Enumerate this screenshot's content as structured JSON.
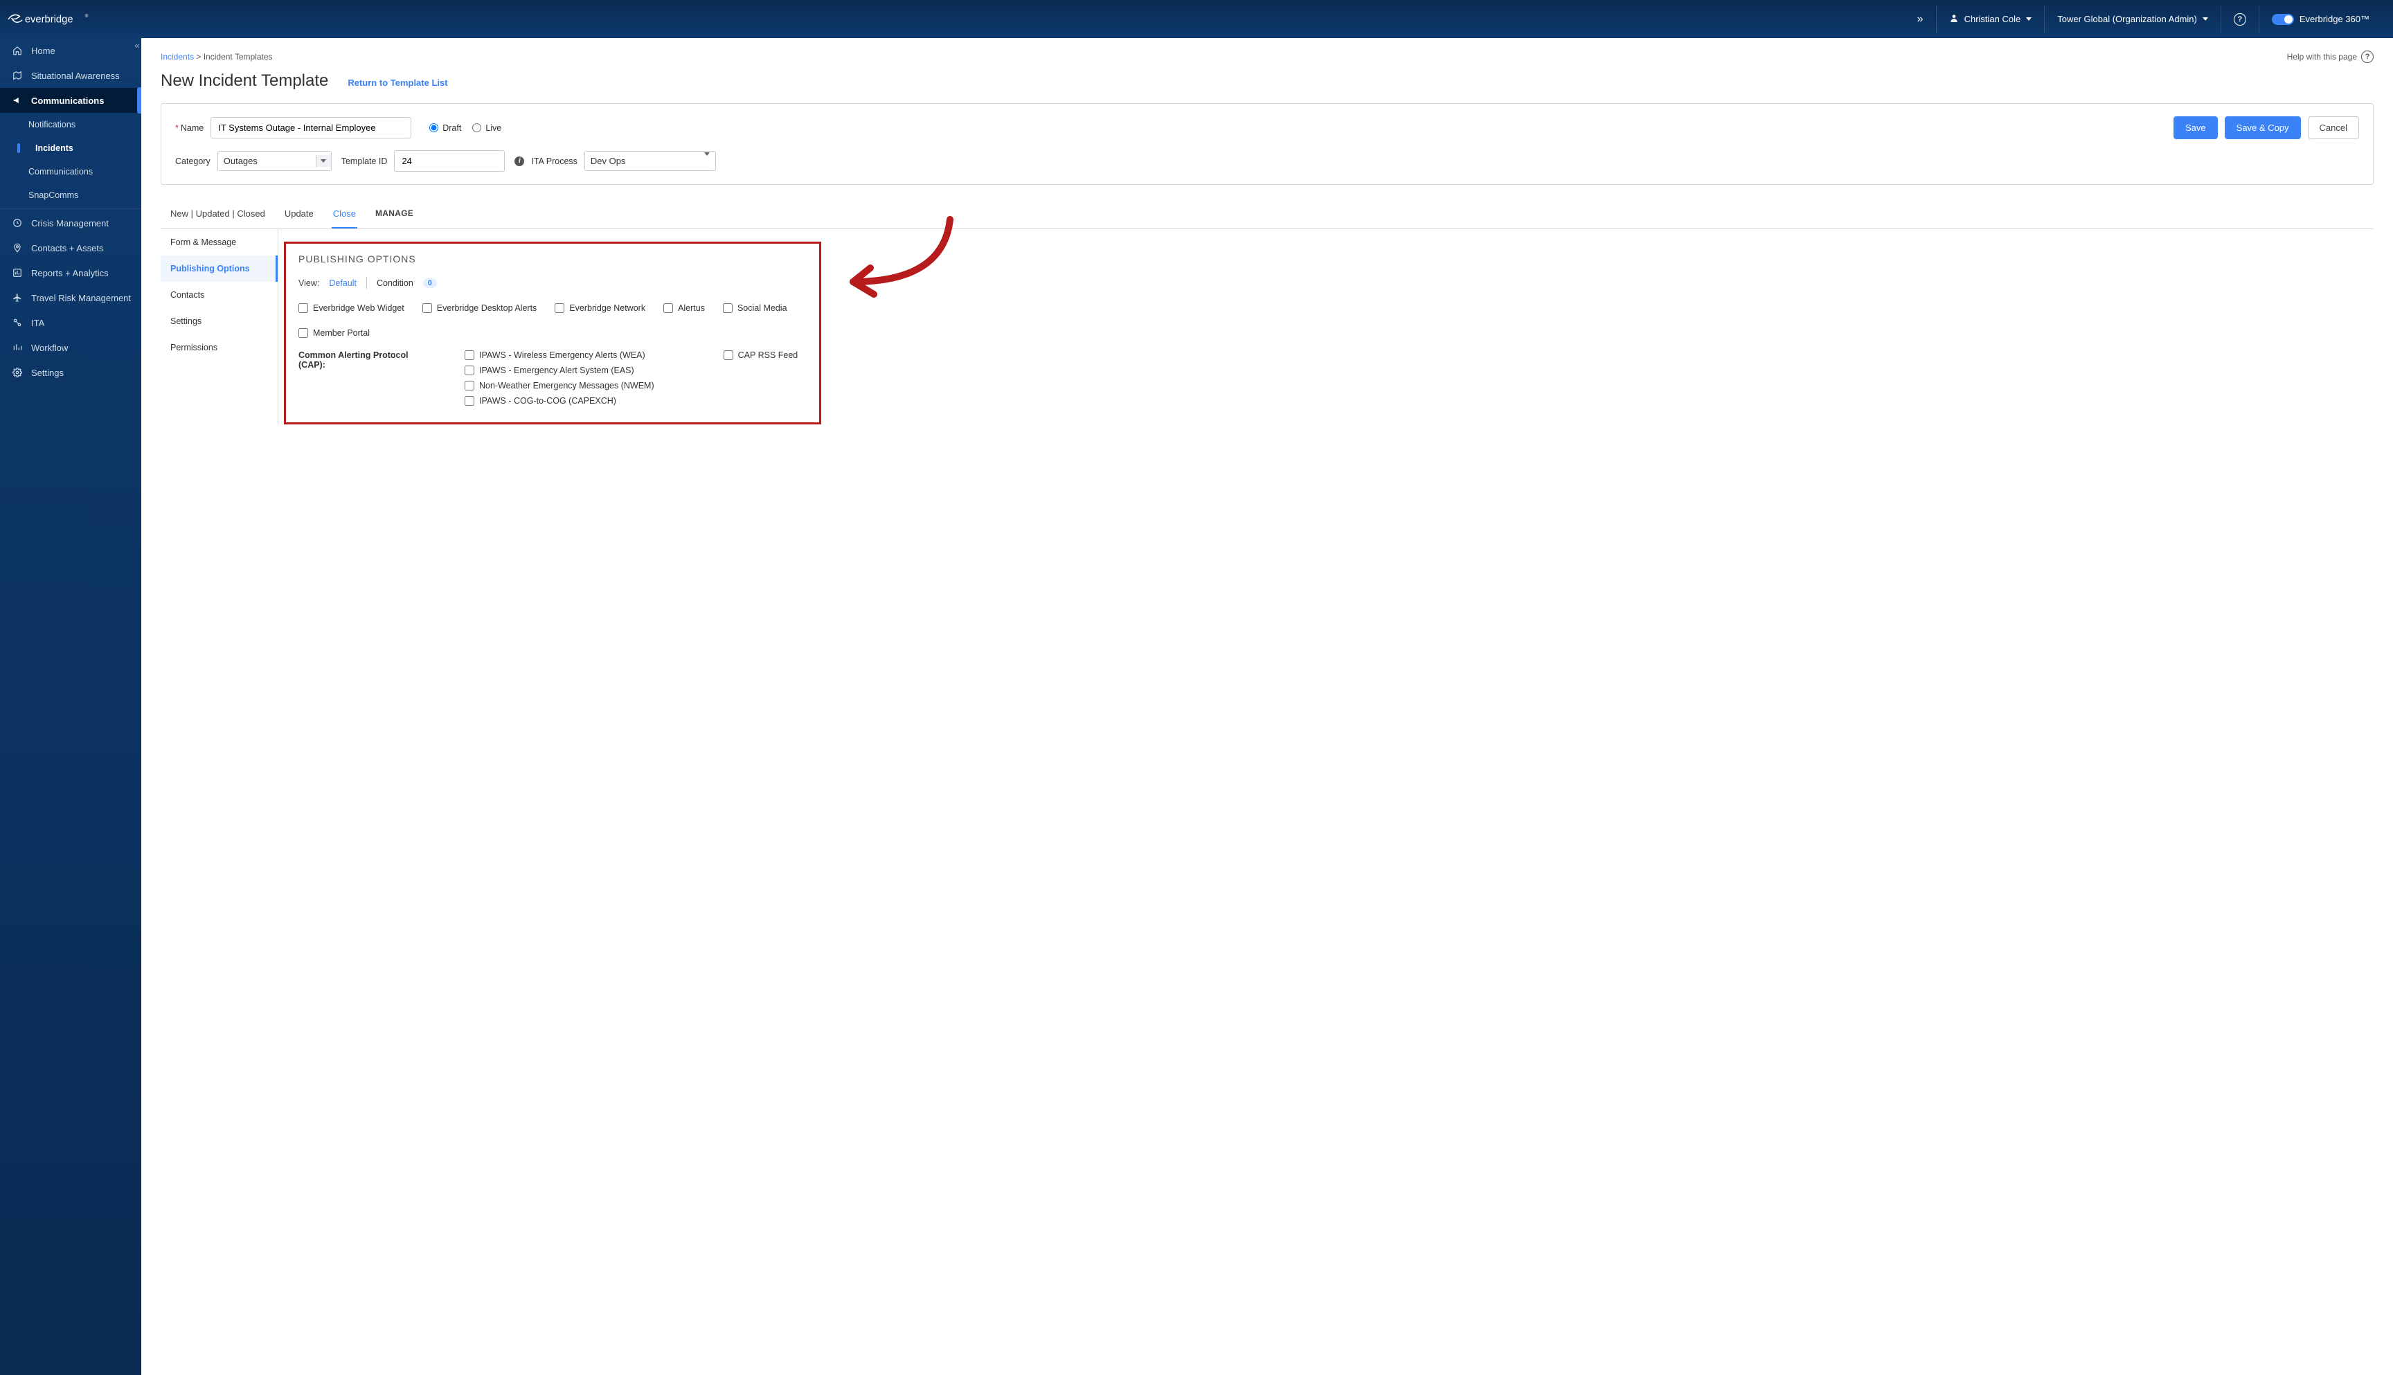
{
  "header": {
    "product": "everbridge",
    "user": "Christian Cole",
    "org": "Tower Global (Organization Admin)",
    "brand_toggle": "Everbridge 360™"
  },
  "sidebar": {
    "items": [
      {
        "label": "Home",
        "icon": "home"
      },
      {
        "label": "Situational Awareness",
        "icon": "map"
      },
      {
        "label": "Communications",
        "icon": "megaphone",
        "active_parent": true
      },
      {
        "label": "Notifications",
        "sub": true
      },
      {
        "label": "Incidents",
        "sub": true,
        "active_sub": true
      },
      {
        "label": "Communications",
        "sub": true
      },
      {
        "label": "SnapComms",
        "sub": true
      },
      {
        "label": "Crisis Management",
        "icon": "clock"
      },
      {
        "label": "Contacts + Assets",
        "icon": "pin"
      },
      {
        "label": "Reports + Analytics",
        "icon": "chart"
      },
      {
        "label": "Travel Risk Management",
        "icon": "plane"
      },
      {
        "label": "ITA",
        "icon": "link"
      },
      {
        "label": "Workflow",
        "icon": "bars"
      },
      {
        "label": "Settings",
        "icon": "gear"
      }
    ]
  },
  "breadcrumb": {
    "root": "Incidents",
    "leaf": "Incident Templates",
    "help": "Help with this page"
  },
  "page": {
    "title": "New Incident Template",
    "return": "Return to Template List"
  },
  "form": {
    "name_label": "Name",
    "name_value": "IT Systems Outage - Internal Employee",
    "draft": "Draft",
    "live": "Live",
    "category_label": "Category",
    "category_value": "Outages",
    "template_id_label": "Template ID",
    "template_id_value": "24",
    "ita_label": "ITA Process",
    "ita_value": "Dev Ops",
    "save": "Save",
    "save_copy": "Save & Copy",
    "cancel": "Cancel"
  },
  "tabs": [
    "New | Updated | Closed",
    "Update",
    "Close",
    "MANAGE"
  ],
  "leftnav": [
    "Form & Message",
    "Publishing Options",
    "Contacts",
    "Settings",
    "Permissions"
  ],
  "publishing": {
    "heading": "PUBLISHING OPTIONS",
    "view_label": "View:",
    "default": "Default",
    "condition": "Condition",
    "condition_count": "0",
    "checks": [
      "Everbridge Web Widget",
      "Everbridge Desktop Alerts",
      "Everbridge Network",
      "Alertus",
      "Social Media",
      "Member Portal"
    ],
    "cap_label": "Common Alerting Protocol (CAP):",
    "cap_items": [
      "IPAWS - Wireless Emergency Alerts (WEA)",
      "IPAWS - Emergency Alert System (EAS)",
      "Non-Weather Emergency Messages (NWEM)",
      "IPAWS - COG-to-COG (CAPEXCH)"
    ],
    "cap_rss": "CAP RSS Feed"
  }
}
